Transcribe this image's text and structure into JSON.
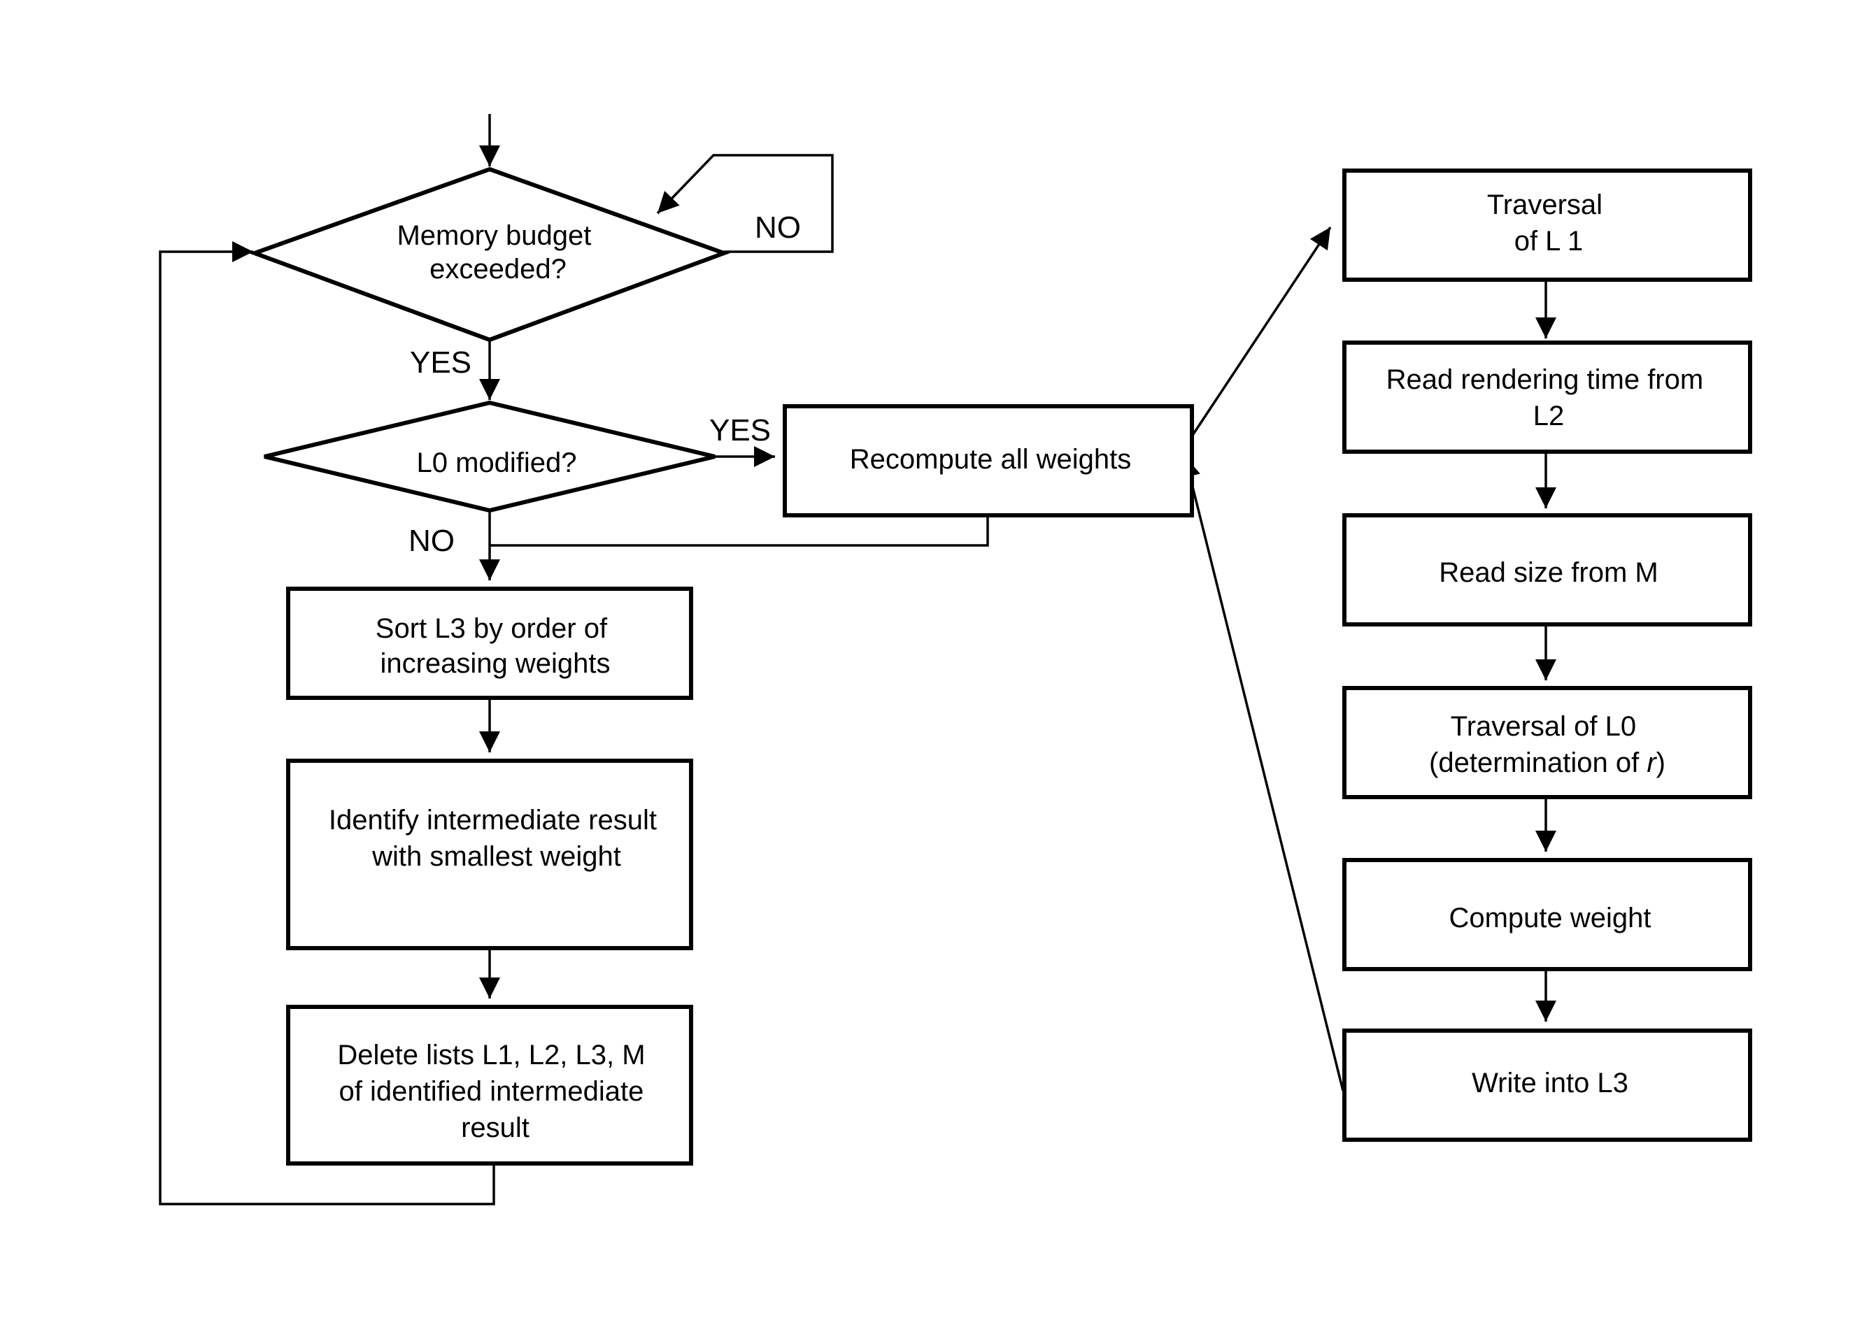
{
  "diagram": {
    "type": "flowchart",
    "decisions": {
      "memory_budget": {
        "lines": [
          "Memory budget",
          "exceeded?"
        ]
      },
      "l0_modified": {
        "lines": [
          "L0 modified?"
        ]
      }
    },
    "left_steps": {
      "sort": {
        "lines": [
          "Sort L3 by order of",
          "increasing weights"
        ]
      },
      "identify": {
        "lines": [
          "Identify  intermediate result",
          "with smallest weight"
        ]
      },
      "delete": {
        "lines": [
          "Delete lists L1, L2, L3, M",
          "of identified intermediate",
          "result"
        ]
      }
    },
    "recompute": {
      "lines": [
        "Recompute all weights"
      ]
    },
    "right_steps": {
      "traversal_l1": {
        "lines": [
          "Traversal",
          "of L 1"
        ]
      },
      "read_time": {
        "lines": [
          "Read rendering time from",
          "L2"
        ]
      },
      "read_size": {
        "lines": [
          "Read size from M"
        ]
      },
      "traversal_l0": {
        "lines": [
          "Traversal of L0",
          "(determination of r)"
        ],
        "italic_suffix": "r"
      },
      "compute_weight": {
        "lines": [
          "Compute weight"
        ]
      },
      "write_l3": {
        "lines": [
          "Write into L3"
        ]
      }
    },
    "branch_labels": {
      "budget_no": "NO",
      "budget_yes": "YES",
      "modified_yes": "YES",
      "modified_no": "NO"
    },
    "colors": {
      "stroke": "#000000",
      "background": "#ffffff"
    }
  }
}
